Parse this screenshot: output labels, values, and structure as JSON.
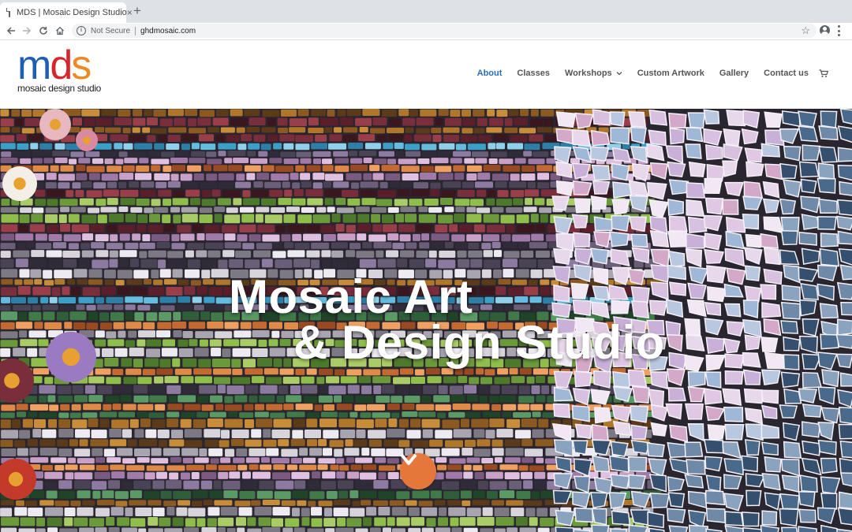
{
  "browser": {
    "tab_title": "MDS | Mosaic Design Studio",
    "tab_close": "×",
    "new_tab": "+",
    "security_label": "Not Secure",
    "url": "ghdmosaic.com",
    "star": "☆"
  },
  "site": {
    "logo_letters": {
      "m": "m",
      "d": "d",
      "s": "s"
    },
    "logo_tagline": "mosaic design studio",
    "colors": {
      "blue": "#1f5fb2",
      "red": "#d6262c",
      "orange": "#ee8a24",
      "accent": "#e5773b"
    },
    "nav": {
      "about": "About",
      "classes": "Classes",
      "workshops": "Workshops",
      "custom_artwork": "Custom Artwork",
      "gallery": "Gallery",
      "contact": "Contact us"
    },
    "active_nav": "About"
  },
  "hero": {
    "title_line1": "Mosaic Art",
    "title_line2": "& Design Studio",
    "icons": {
      "scroll": "chevron-down-icon",
      "cart": "cart-icon"
    }
  }
}
